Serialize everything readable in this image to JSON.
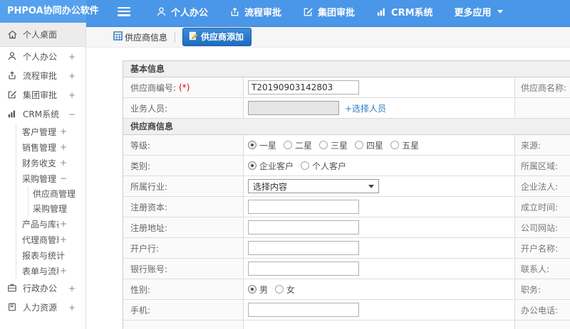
{
  "colors": {
    "header_blue": "#4a96e8",
    "logo_blue": "#55a1ee",
    "active_tab_blue": "#1d6cc0",
    "link_blue": "#2d7dc5",
    "required_red": "#e60000"
  },
  "app": {
    "logo": "PHPOA协同办公软件"
  },
  "topnav": {
    "items": [
      {
        "label": "个人办公",
        "icon": "user-icon"
      },
      {
        "label": "流程审批",
        "icon": "share-icon"
      },
      {
        "label": "集团审批",
        "icon": "edit-icon"
      },
      {
        "label": "CRM系统",
        "icon": "chart-icon"
      },
      {
        "label": "更多应用",
        "icon": "caret-down-icon"
      }
    ]
  },
  "sidebar": {
    "items": [
      {
        "label": "个人桌面",
        "icon": "home-icon",
        "expander": "",
        "active": true
      },
      {
        "label": "个人办公",
        "icon": "user-icon",
        "expander": "+"
      },
      {
        "label": "流程审批",
        "icon": "share-icon",
        "expander": "+"
      },
      {
        "label": "集团审批",
        "icon": "edit-icon",
        "expander": "+"
      },
      {
        "label": "CRM系统",
        "icon": "chart-icon",
        "expander": "−"
      },
      {
        "label": "客户管理",
        "expander": "+"
      },
      {
        "label": "销售管理",
        "expander": "+"
      },
      {
        "label": "财务收支",
        "expander": "+"
      },
      {
        "label": "采购管理",
        "expander": "−"
      },
      {
        "label": "供应商管理",
        "expander": ""
      },
      {
        "label": "采购管理",
        "expander": ""
      },
      {
        "label": "产品与库存",
        "expander": "+"
      },
      {
        "label": "代理商管理",
        "expander": "+"
      },
      {
        "label": "报表与统计",
        "expander": ""
      },
      {
        "label": "表单与流程设置",
        "expander": "+"
      },
      {
        "label": "行政办公",
        "icon": "cabinet-icon",
        "expander": "+"
      },
      {
        "label": "人力资源",
        "icon": "book-icon",
        "expander": "+"
      }
    ]
  },
  "tabs": [
    {
      "label": "供应商信息",
      "icon": "table-icon",
      "active": false
    },
    {
      "label": "供应商添加",
      "icon": "add-doc-icon",
      "active": true
    }
  ],
  "form": {
    "sections": [
      {
        "title": "基本信息",
        "rows": [
          {
            "label": "供应商编号:",
            "req": "(*)",
            "input_value": "T20190903142803",
            "right_label": "供应商名称:",
            "right_req": "(*)"
          },
          {
            "label": "业务人员:",
            "req": "",
            "link": "+选择人员",
            "right_label": "",
            "right_req": ""
          }
        ]
      },
      {
        "title": "供应商信息",
        "rows": [
          {
            "label": "等级:",
            "right_label": "来源:",
            "options": [
              {
                "label": "一星",
                "checked": true
              },
              {
                "label": "二星",
                "checked": false
              },
              {
                "label": "三星",
                "checked": false
              },
              {
                "label": "四星",
                "checked": false
              },
              {
                "label": "五星",
                "checked": false
              }
            ]
          },
          {
            "label": "类别:",
            "right_label": "所属区域:",
            "options": [
              {
                "label": "企业客户",
                "checked": true
              },
              {
                "label": "个人客户",
                "checked": false
              }
            ]
          },
          {
            "label": "所属行业:",
            "right_label": "企业法人:",
            "select_value": "选择内容"
          },
          {
            "label": "注册资本:",
            "right_label": "成立时间:"
          },
          {
            "label": "注册地址:",
            "right_label": "公司网站:"
          },
          {
            "label": "开户行:",
            "right_label": "开户名称:"
          },
          {
            "label": "银行账号:",
            "right_label": "联系人:"
          },
          {
            "label": "性别:",
            "right_label": "职务:",
            "options": [
              {
                "label": "男",
                "checked": true
              },
              {
                "label": "女",
                "checked": false
              }
            ]
          },
          {
            "label": "手机:",
            "right_label": "办公电话:"
          }
        ]
      }
    ]
  }
}
